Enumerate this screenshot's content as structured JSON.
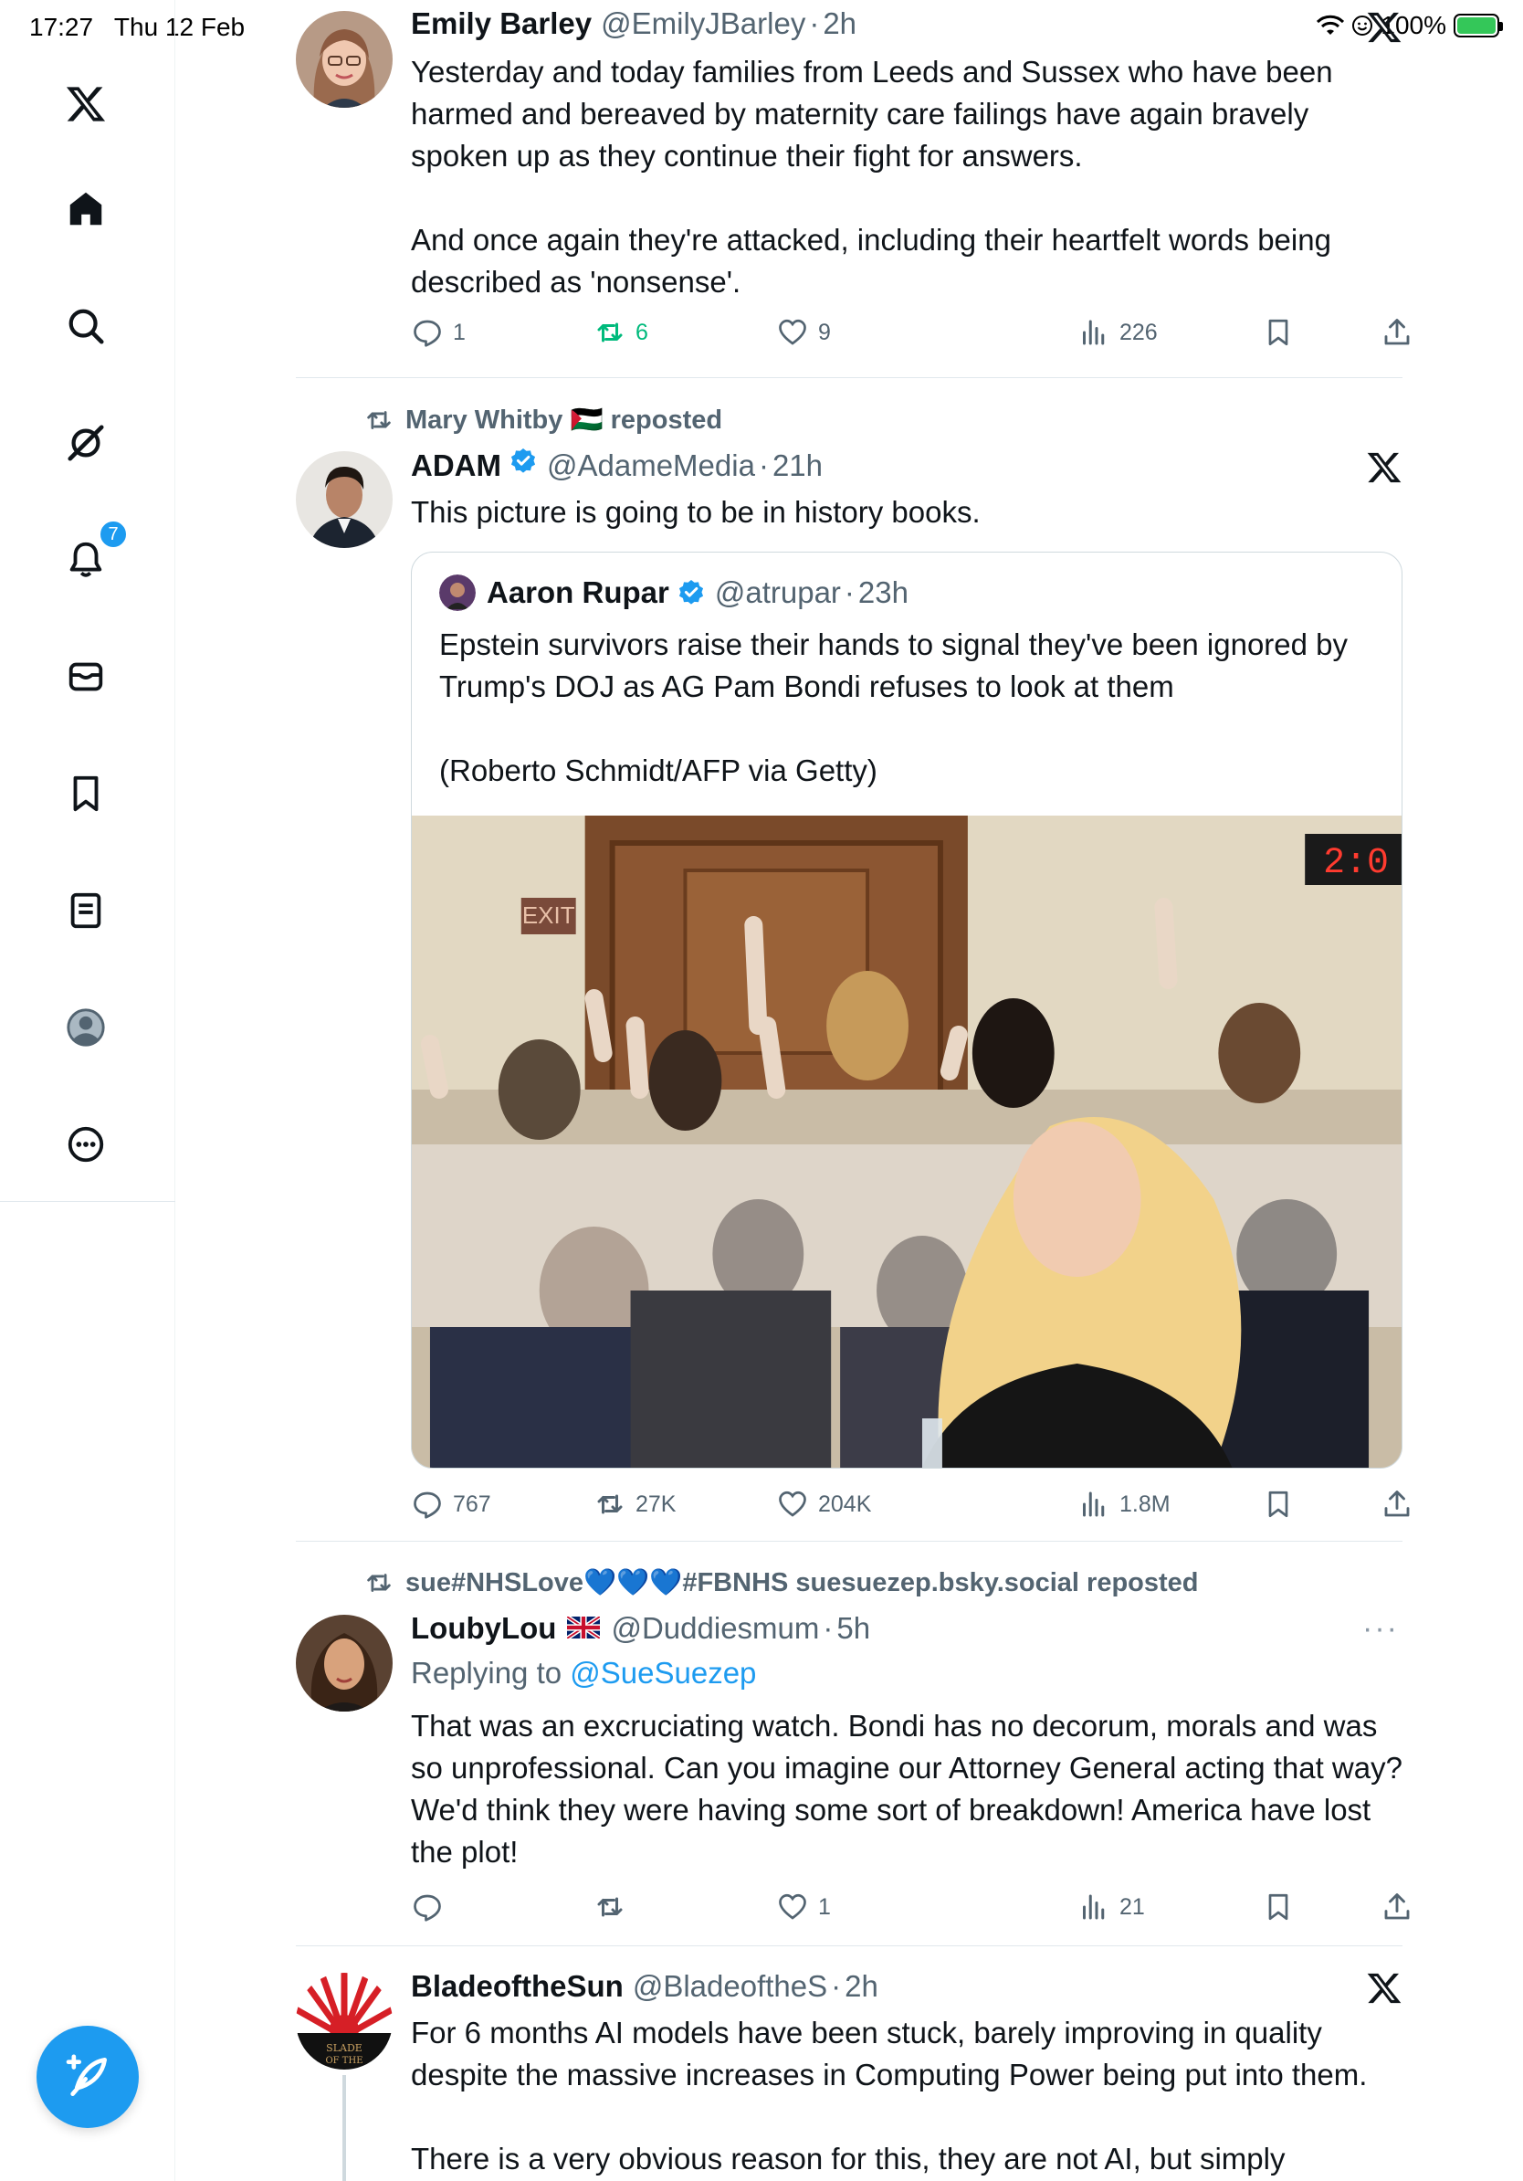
{
  "status": {
    "time": "17:27",
    "date": "Thu 12 Feb",
    "battery": "100%",
    "battery_level": 1.0
  },
  "sidebar": {
    "items": [
      {
        "name": "x-logo-icon"
      },
      {
        "name": "home-icon"
      },
      {
        "name": "search-icon"
      },
      {
        "name": "grok-icon"
      },
      {
        "name": "notifications-icon",
        "badge": "7"
      },
      {
        "name": "messages-icon"
      },
      {
        "name": "bookmarks-icon"
      },
      {
        "name": "lists-icon"
      },
      {
        "name": "profile-icon"
      },
      {
        "name": "more-icon"
      }
    ]
  },
  "tweets": [
    {
      "name": "Emily Barley",
      "handle": "@EmilyJBarley",
      "time": "2h",
      "text": "Yesterday and today families from Leeds and Sussex who have been harmed and bereaved by maternity care failings have again bravely spoken up as they continue their fight for answers.\n\nAnd once again they're attacked, including their heartfelt words being described as 'nonsense'.",
      "replies": "1",
      "reposts": "6",
      "likes": "9",
      "views": "226"
    },
    {
      "reposted_by": "Mary Whitby 🇵🇸 reposted",
      "name": "ADAM",
      "handle": "@AdameMedia",
      "time": "21h",
      "text": "This picture is going to be in history books.",
      "quote": {
        "name": "Aaron Rupar",
        "handle": "@atrupar",
        "time": "23h",
        "text": "Epstein survivors raise their hands to signal they've been ignored by Trump's DOJ as AG Pam Bondi refuses to look at them\n\n(Roberto Schmidt/AFP via Getty)",
        "photo_clock": "2:0",
        "photo_exit": "EXIT"
      },
      "replies": "767",
      "reposts": "27K",
      "likes": "204K",
      "views": "1.8M"
    },
    {
      "reposted_by": "sue#NHSLove💙💙💙#FBNHS suesuezep.bsky.social reposted",
      "name": "LoubyLou",
      "handle": "@Duddiesmum",
      "time": "5h",
      "replying_prefix": "Replying to ",
      "replying_to": "@SueSuezep",
      "text": "That was an excruciating watch. Bondi has no decorum, morals and was so unprofessional. Can you imagine our Attorney General acting that way? We'd think they were having some sort of breakdown! America have lost the plot!",
      "replies": "",
      "reposts": "",
      "likes": "1",
      "views": "21"
    },
    {
      "name": "BladeoftheSun",
      "handle": "@BladeoftheS",
      "time": "2h",
      "text": "For 6 months AI models have been stuck, barely improving in quality despite the massive increases in Computing Power being put into them.\n\nThere is a very obvious reason for this, they are not AI, but simply"
    }
  ],
  "colors": {
    "accent": "#1d9bf0",
    "repost_green": "#00ba7c",
    "muted": "#536471",
    "battery_green": "#34c759"
  }
}
